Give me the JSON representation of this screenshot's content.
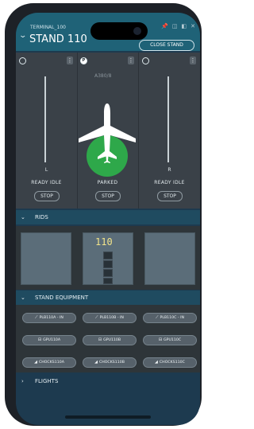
{
  "header": {
    "terminal": "TERMINAL_100",
    "stand_title": "STAND 110",
    "close_button": "CLOSE STAND",
    "icons": [
      "pin-icon",
      "panel-icon",
      "split-icon",
      "close-icon"
    ]
  },
  "gates": [
    {
      "indicator": "",
      "aircraft": "",
      "side": "L",
      "status": "READY IDLE",
      "stop": "STOP"
    },
    {
      "indicator": "P",
      "aircraft": "A380/8",
      "side": "C",
      "status": "PARKED",
      "stop": "STOP"
    },
    {
      "indicator": "",
      "aircraft": "",
      "side": "R",
      "status": "READY IDLE",
      "stop": "STOP"
    }
  ],
  "rids": {
    "section_label": "RIDS",
    "display_value": "110"
  },
  "equipment": {
    "section_label": "STAND EQUIPMENT",
    "buttons": [
      [
        "PLB110A - IN",
        "PLB110B - IN",
        "PLB110C - IN"
      ],
      [
        "GPU110A",
        "GPU110B",
        "GPU110C"
      ],
      [
        "CHOCKS110A",
        "CHOCKS110B",
        "CHOCKS110C"
      ]
    ]
  },
  "flights": {
    "section_label": "FLIGHTS"
  },
  "colors": {
    "header": "#1f6277",
    "parked_green": "#2ea84a",
    "rids_text": "#f1e38a"
  }
}
